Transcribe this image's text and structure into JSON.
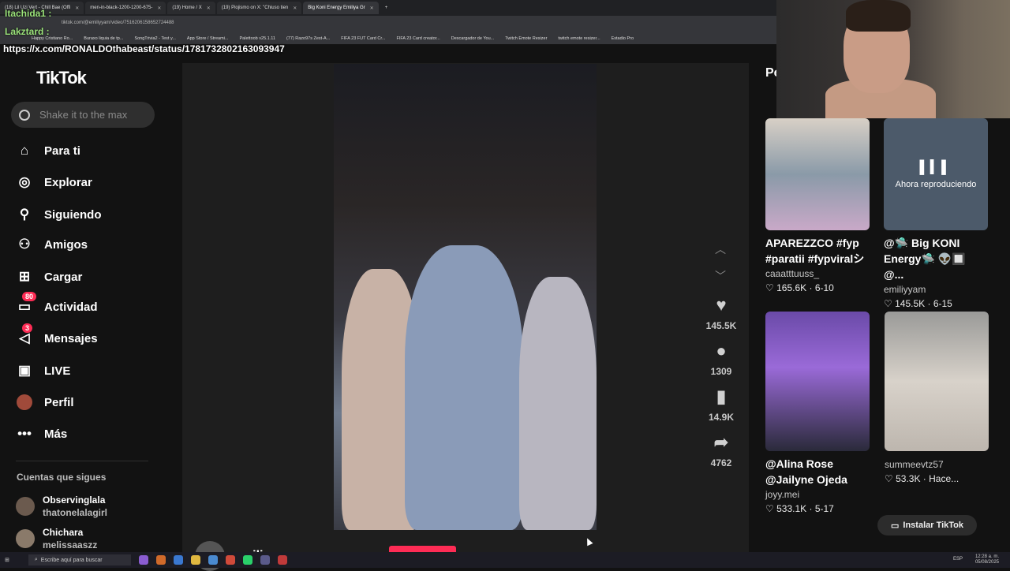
{
  "browser": {
    "tabs": [
      "(18) Lil Uzi Vert - Chill Bae (Offi",
      "men-in-black-1200-1200-675-",
      "(19) Home / X",
      "(19) Piojismo on X: \"Chiuso tien",
      "Big Koni Energy Emiliya Gr"
    ],
    "url": "tiktok.com/@emiliyyam/video/7516206158652724488",
    "bookmarks": [
      "Happy Cristiano Ro...",
      "Buraxo liquia de tp...",
      "SongTrivia2 - Test y...",
      "App Store / Streami...",
      "Palettoob v25.1.11",
      "(77) Razo97s Zest-A...",
      "FIFA 23 FUT Card Cr...",
      "FIFA 23 Card creator...",
      "Descargador de You...",
      "Twitch Emote Resizer",
      "twitch emote resizer...",
      "Estadio Pro"
    ]
  },
  "overlay": {
    "chat_user1": "Itachida1 :",
    "chat_user2": "Lakztard :",
    "chat_url": "https://x.com/RONALDOthabeast/status/1781732802163093947"
  },
  "tiktok": {
    "logo": "TikTok",
    "search_placeholder": "Shake it to the max",
    "nav": [
      {
        "label": "Para ti",
        "icon": "home-icon"
      },
      {
        "label": "Explorar",
        "icon": "compass-icon"
      },
      {
        "label": "Siguiendo",
        "icon": "following-icon"
      },
      {
        "label": "Amigos",
        "icon": "friends-icon"
      },
      {
        "label": "Cargar",
        "icon": "upload-icon"
      },
      {
        "label": "Actividad",
        "icon": "activity-icon",
        "badge": "80"
      },
      {
        "label": "Mensajes",
        "icon": "messages-icon",
        "badge": "3"
      },
      {
        "label": "LIVE",
        "icon": "live-icon"
      },
      {
        "label": "Perfil",
        "icon": "profile-icon"
      },
      {
        "label": "Más",
        "icon": "more-icon"
      }
    ],
    "following_title": "Cuentas que sigues",
    "following": [
      {
        "name": "Observinglala",
        "handle": "thatonelalagirl"
      },
      {
        "name": "Chichara",
        "handle": "melissaaszz"
      }
    ],
    "video": {
      "likes": "145.5K",
      "comments": "1309",
      "saves": "14.9K",
      "shares": "4762",
      "author": "emiliyyam"
    },
    "right_panel_title": "Pe",
    "cards": [
      {
        "caption": "APAREZZCO #fyp #paratii #fypviralシ",
        "user": "caaatttuuss_",
        "likes": "165.6K",
        "date": "6-10"
      },
      {
        "caption": "@🛸 Big KONI Energy🛸 👽🔲 @...",
        "user": "emiliyyam",
        "likes": "145.5K",
        "date": "6-15",
        "now_playing": "Ahora reproduciendo"
      },
      {
        "caption": "@Alina Rose @Jailyne Ojeda",
        "user": "joyy.mei",
        "likes": "533.1K",
        "date": "5-17"
      },
      {
        "caption": "",
        "user": "summeevtz57",
        "likes": "53.3K",
        "date": "Hace..."
      }
    ],
    "install_label": "Instalar TikTok"
  },
  "taskbar": {
    "search_placeholder": "Escribe aquí para buscar",
    "time": "12:28 a. m.",
    "date": "05/08/2025",
    "lang": "ESP"
  }
}
